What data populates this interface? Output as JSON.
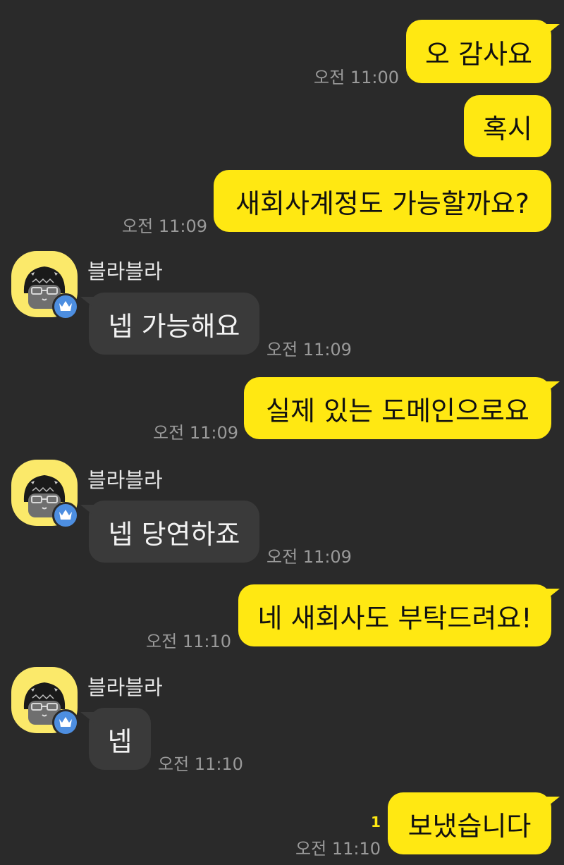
{
  "messages": [
    {
      "from": "me",
      "text": "오 감사요",
      "time": "오전 11:00"
    },
    {
      "from": "me",
      "text": "혹시",
      "time": ""
    },
    {
      "from": "me",
      "text": "새회사계정도 가능할까요?",
      "time": "오전 11:09"
    },
    {
      "from": "other",
      "sender": "블라블라",
      "text": "넵 가능해요",
      "time": "오전 11:09"
    },
    {
      "from": "me",
      "text": "실제 있는 도메인으로요",
      "time": "오전 11:09"
    },
    {
      "from": "other",
      "sender": "블라블라",
      "text": "넵 당연하죠",
      "time": "오전 11:09"
    },
    {
      "from": "me",
      "text": "네 새회사도 부탁드려요!",
      "time": "오전 11:10"
    },
    {
      "from": "other",
      "sender": "블라블라",
      "text": "넵",
      "time": "오전 11:10"
    },
    {
      "from": "me",
      "text": "보냈습니다",
      "time": "오전 11:10",
      "unread_count": "1"
    }
  ],
  "icons": {
    "avatar": "character-avatar-icon",
    "badge": "crown-icon"
  },
  "colors": {
    "background": "#2a2a2a",
    "my_bubble": "#ffe812",
    "their_bubble": "#3a3a3a",
    "timestamp": "#9a9a9a",
    "badge": "#4d8ee0"
  }
}
